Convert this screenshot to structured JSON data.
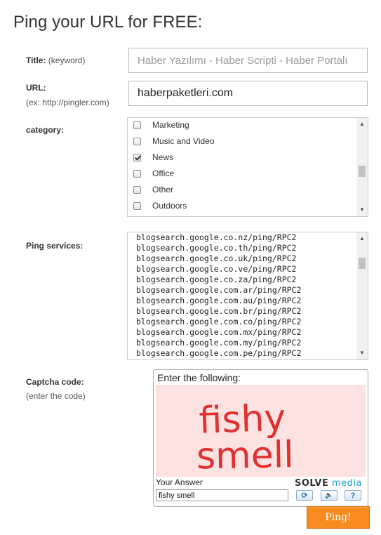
{
  "page": {
    "title": "Ping your URL for FREE:"
  },
  "title_field": {
    "label": "Title:",
    "sublabel": "(keyword)",
    "placeholder": "Haber Yazılımı - Haber Scripti - Haber Portalı",
    "value": ""
  },
  "url_field": {
    "label": "URL:",
    "sublabel": "(ex: http://pingler.com)",
    "value": "haberpaketleri.com"
  },
  "category": {
    "label": "category:",
    "items": [
      {
        "label": "Marketing",
        "checked": false
      },
      {
        "label": "Music and Video",
        "checked": false
      },
      {
        "label": "News",
        "checked": true
      },
      {
        "label": "Office",
        "checked": false
      },
      {
        "label": "Other",
        "checked": false
      },
      {
        "label": "Outdoors",
        "checked": false
      }
    ]
  },
  "ping_services": {
    "label": "Ping services:",
    "lines": [
      "blogsearch.google.co.nz/ping/RPC2",
      "blogsearch.google.co.th/ping/RPC2",
      "blogsearch.google.co.uk/ping/RPC2",
      "blogsearch.google.co.ve/ping/RPC2",
      "blogsearch.google.co.za/ping/RPC2",
      "blogsearch.google.com.ar/ping/RPC2",
      "blogsearch.google.com.au/ping/RPC2",
      "blogsearch.google.com.br/ping/RPC2",
      "blogsearch.google.com.co/ping/RPC2",
      "blogsearch.google.com.mx/ping/RPC2",
      "blogsearch.google.com.my/ping/RPC2",
      "blogsearch.google.com.pe/ping/RPC2"
    ]
  },
  "captcha": {
    "label": "Captcha code:",
    "sublabel": "(enter the code)",
    "prompt": "Enter the following:",
    "challenge_line1": "fishy",
    "challenge_line2": "smell",
    "answer_label": "Your Answer",
    "answer_value": "fishy smell",
    "logo_solve": "SOLVE",
    "logo_media": "media",
    "challenge_color": "#e03131",
    "controls": [
      {
        "name": "refresh-icon",
        "glyph": "⟳"
      },
      {
        "name": "audio-icon",
        "glyph": "🔈"
      },
      {
        "name": "help-icon",
        "glyph": "?"
      }
    ]
  },
  "submit": {
    "label": "Ping!",
    "color": "#f78b1f"
  }
}
